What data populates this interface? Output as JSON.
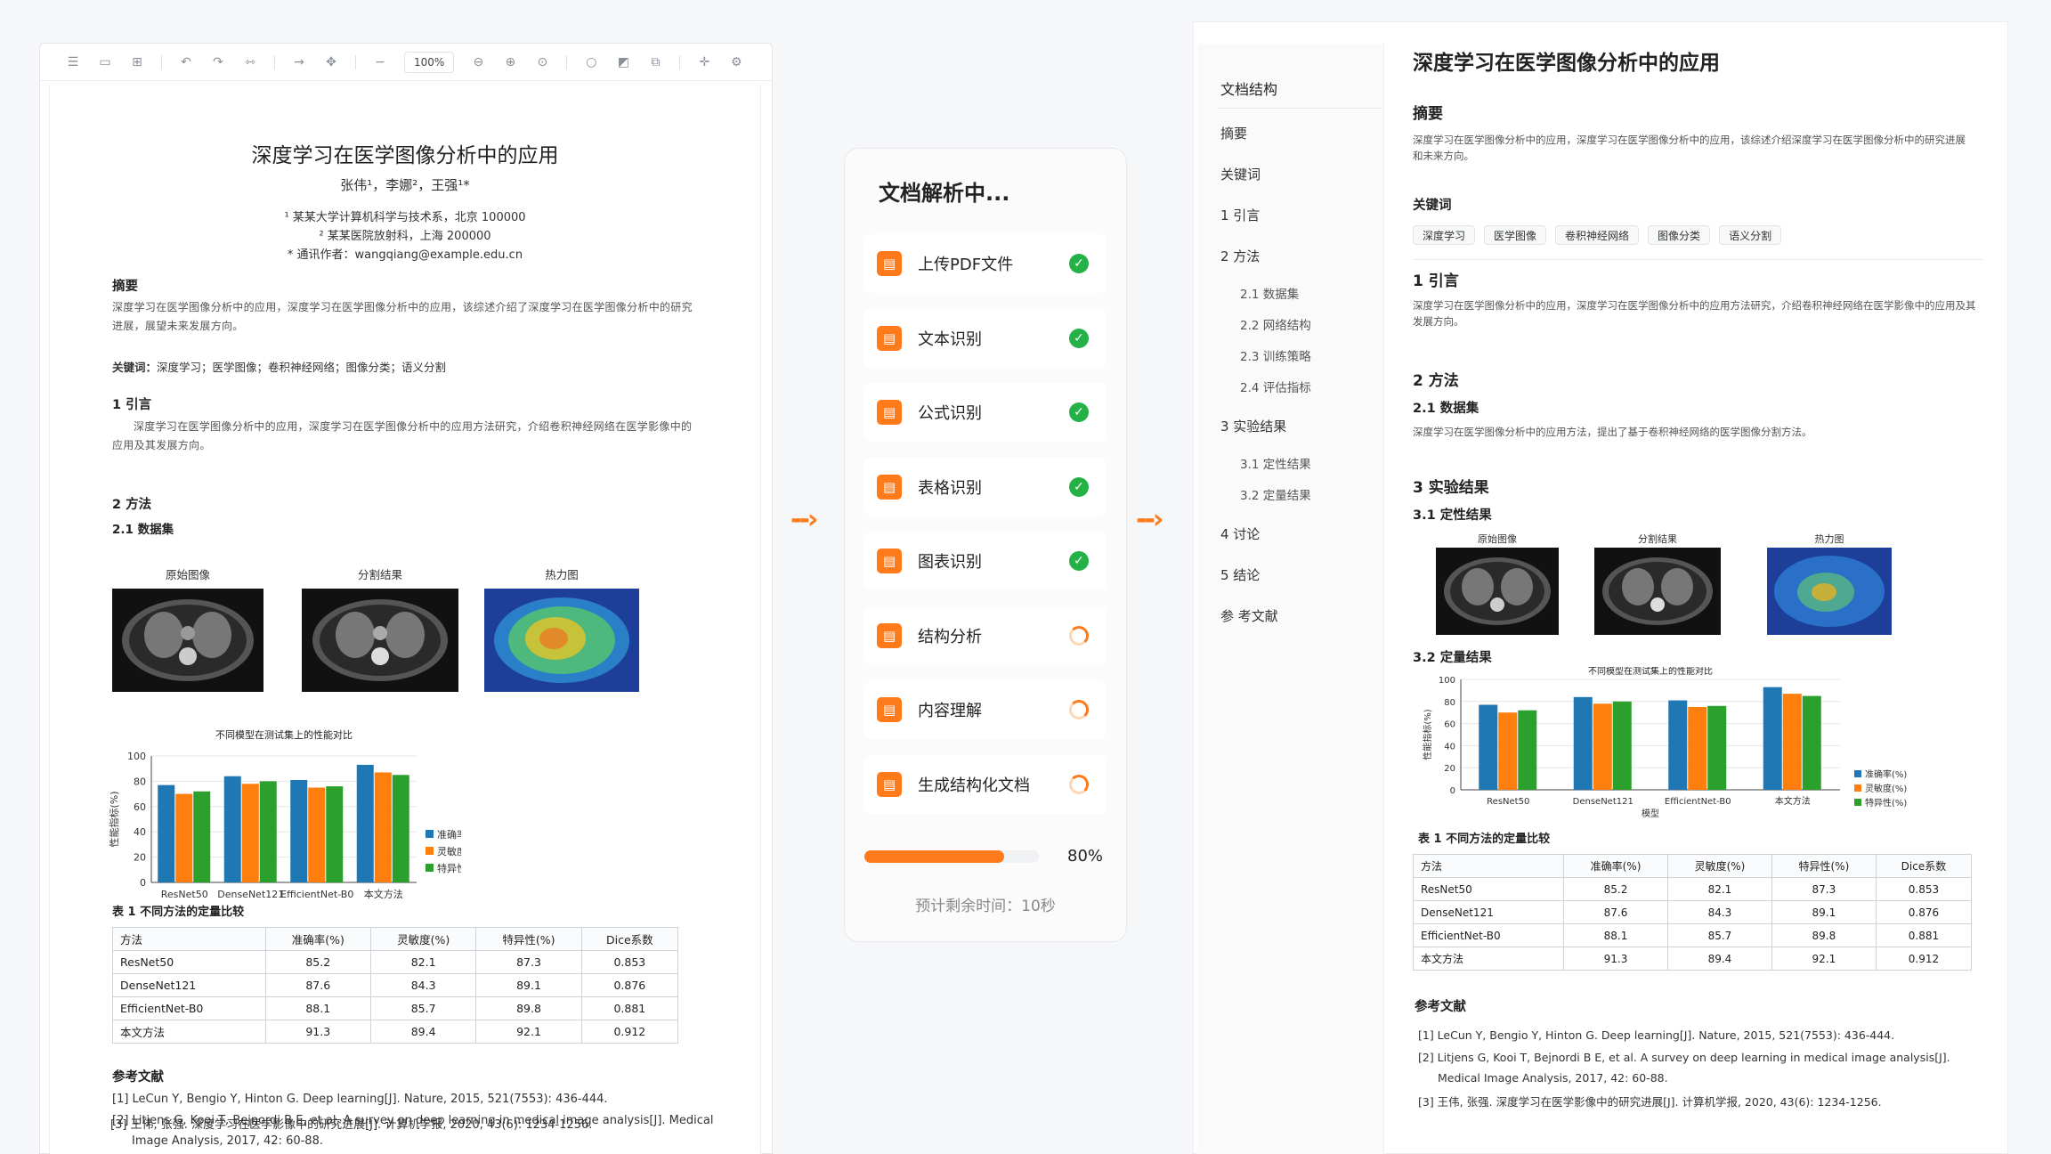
{
  "viewer": {
    "zoom": "100%",
    "toolbar_icons": [
      "sidebar-icon",
      "page-icon",
      "grid-icon",
      "undo-icon",
      "redo-icon",
      "flip-icon",
      "arrow-icon",
      "move-icon",
      "minus-icon",
      "zoom-out-icon",
      "zoom-in-icon",
      "fit-icon",
      "circle-icon",
      "stamp-icon",
      "crop-icon",
      "cursor-icon",
      "settings-icon"
    ]
  },
  "paper": {
    "title": "深度学习在医学图像分析中的应用",
    "authors": "张伟¹，李娜²，王强¹*",
    "aff1": "¹ 某某大学计算机科学与技术系，北京 100000",
    "aff2": "² 某某医院放射科，上海 200000",
    "corr": "* 通讯作者：wangqiang@example.edu.cn",
    "abstract_h": "摘要",
    "abstract": "深度学习在医学图像分析中的应用，深度学习在医学图像分析中的应用，该综述介绍了深度学习在医学图像分析中的研究进展，展望未来发展方向。",
    "keywords_label": "关键词：",
    "keywords": "深度学习；医学图像；卷积神经网络；图像分类；语义分割",
    "s1": "1  引言",
    "s1_text": "深度学习在医学图像分析中的应用，深度学习在医学图像分析中的应用方法研究，介绍卷积神经网络在医学影像中的应用及其发展方向。",
    "s2": "2  方法",
    "s21": "2.1  数据集",
    "img_labels": [
      "原始图像",
      "分割结果",
      "热力图"
    ],
    "table_title": "表 1   不同方法的定量比较",
    "ref_h": "参考文献",
    "refs": [
      "[1] LeCun Y, Bengio Y, Hinton G. Deep learning[J]. Nature, 2015, 521(7553): 436-444.",
      "[2] Litjens G, Kooi T, Bejnordi B E, et al. A survey on deep learning in medical image analysis[J]. Medical",
      "Image Analysis, 2017, 42: 60-88.",
      "[3] 王伟, 张强. 深度学习在医学影像中的研究进展[J]. 计算机学报, 2020, 43(6): 1234-1256."
    ]
  },
  "chart_data": {
    "type": "bar",
    "title": "不同模型在测试集上的性能对比",
    "ylabel": "性能指标(%)",
    "xlabel": "",
    "ylim": [
      0,
      100
    ],
    "yticks": [
      0,
      20,
      40,
      60,
      80,
      100
    ],
    "categories": [
      "ResNet50",
      "DenseNet121",
      "EfficientNet-B0",
      "本文方法"
    ],
    "series": [
      {
        "name": "准确率(%)",
        "color": "#1f77b4",
        "values": [
          77,
          84,
          81,
          93
        ]
      },
      {
        "name": "灵敏度(%)",
        "color": "#ff7f0e",
        "values": [
          70,
          78,
          75,
          87
        ]
      },
      {
        "name": "特异性(%)",
        "color": "#2ca02c",
        "values": [
          72,
          80,
          76,
          85
        ]
      }
    ],
    "legend": "right",
    "grid": true
  },
  "table": {
    "headers": [
      "方法",
      "准确率(%)",
      "灵敏度(%)",
      "特异性(%)",
      "Dice系数"
    ],
    "rows": [
      [
        "ResNet50",
        "85.2",
        "82.1",
        "87.3",
        "0.853"
      ],
      [
        "DenseNet121",
        "87.6",
        "84.3",
        "89.1",
        "0.876"
      ],
      [
        "EfficientNet-B0",
        "88.1",
        "85.7",
        "89.8",
        "0.881"
      ],
      [
        "本文方法",
        "91.3",
        "89.4",
        "92.1",
        "0.912"
      ]
    ]
  },
  "parser": {
    "title": "文档解析中...",
    "steps": [
      {
        "label": "上传PDF文件",
        "status": "done",
        "icon": "pdf-file-icon"
      },
      {
        "label": "文本识别",
        "status": "done",
        "icon": "text-icon"
      },
      {
        "label": "公式识别",
        "status": "done",
        "icon": "formula-icon"
      },
      {
        "label": "表格识别",
        "status": "done",
        "icon": "table-icon"
      },
      {
        "label": "图表识别",
        "status": "done",
        "icon": "chart-icon"
      },
      {
        "label": "结构分析",
        "status": "loading",
        "icon": "structure-icon"
      },
      {
        "label": "内容理解",
        "status": "loading",
        "icon": "understanding-icon"
      },
      {
        "label": "生成结构化文档",
        "status": "loading",
        "icon": "document-icon"
      }
    ],
    "progress": 0.8,
    "progress_text": "80%",
    "eta": "预计剩余时间：10秒",
    "accent": "#ff7a1a"
  },
  "outline": {
    "title": "文档结构",
    "items": [
      {
        "label": "摘要",
        "level": 1
      },
      {
        "label": "关键词",
        "level": 1
      },
      {
        "label": "1   引言",
        "level": 1
      },
      {
        "label": "2   方法",
        "level": 1
      },
      {
        "label": "2.1   数据集",
        "level": 2
      },
      {
        "label": "2.2   网络结构",
        "level": 2
      },
      {
        "label": "2.3   训练策略",
        "level": 2
      },
      {
        "label": "2.4   评估指标",
        "level": 2
      },
      {
        "label": "3   实验结果",
        "level": 1
      },
      {
        "label": "3.1   定性结果",
        "level": 2
      },
      {
        "label": "3.2   定量结果",
        "level": 2
      },
      {
        "label": "4   讨论",
        "level": 1
      },
      {
        "label": "5   结论",
        "level": 1
      },
      {
        "label": "参 考文献",
        "level": 1
      }
    ]
  },
  "result": {
    "title": "深度学习在医学图像分析中的应用",
    "abstract_h": "摘要",
    "abstract": "深度学习在医学图像分析中的应用，深度学习在医学图像分析中的应用，该综述介绍深度学习在医学图像分析中的研究进展和未来方向。",
    "keywords_h": "关键词",
    "keywords": [
      "深度学习",
      "医学图像",
      "卷积神经网络",
      "图像分类",
      "语义分割"
    ],
    "s1": "1  引言",
    "s1_text": "深度学习在医学图像分析中的应用，深度学习在医学图像分析中的应用方法研究，介绍卷积神经网络在医学影像中的应用及其发展方向。",
    "s2": "2  方法",
    "s21": "2.1  数据集",
    "s21_text": "深度学习在医学图像分析中的应用方法，提出了基于卷积神经网络的医学图像分割方法。",
    "s3": "3  实验结果",
    "s31": "3.1  定性结果",
    "s32": "3.2  定量结果",
    "chart_xlabel": "模型",
    "table_title": "表 1   不同方法的定量比较",
    "ref_h": "参考文献",
    "refs": [
      "[1] LeCun Y, Bengio Y, Hinton G. Deep learning[J]. Nature, 2015, 521(7553): 436-444.",
      "[2] Litjens G, Kooi T, Bejnordi B E, et al. A survey on deep learning in medical image analysis[J].",
      "Medical Image Analysis, 2017, 42: 60-88.",
      "[3] 王伟, 张强. 深度学习在医学影像中的研究进展[J]. 计算机学报, 2020, 43(6): 1234-1256."
    ]
  }
}
